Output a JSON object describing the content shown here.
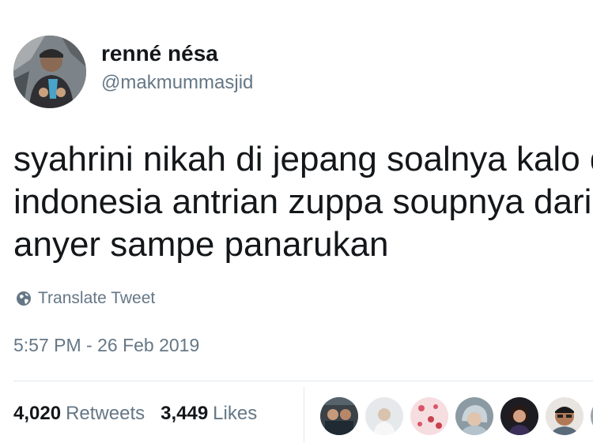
{
  "tweet": {
    "display_name": "renné nésa",
    "handle": "@makmummasjid",
    "text_lines": [
      "syahrini nikah di jepang soalnya kalo di",
      "indonesia antrian zuppa soupnya dari",
      "anyer sampe panarukan"
    ],
    "translate_label": "Translate Tweet",
    "timestamp": "5:57 PM - 26 Feb 2019"
  },
  "stats": {
    "retweets_count": "4,020",
    "retweets_label": "Retweets",
    "likes_count": "3,449",
    "likes_label": "Likes"
  },
  "colors": {
    "text_primary": "#14171a",
    "text_secondary": "#657786",
    "divider": "#e1e8ed"
  },
  "icons": {
    "translate": "globe-icon"
  }
}
